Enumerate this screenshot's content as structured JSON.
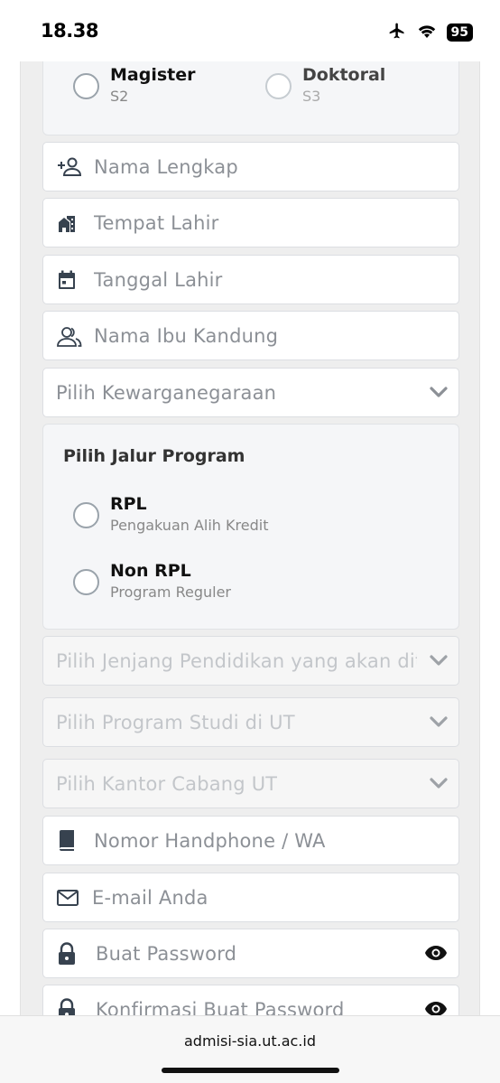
{
  "status": {
    "time": "18.38",
    "battery": "95"
  },
  "degree": {
    "options": [
      {
        "title": "Magister",
        "subtitle": "S2"
      },
      {
        "title": "Doktoral",
        "subtitle": "S3"
      }
    ]
  },
  "form": {
    "full_name": "Nama Lengkap",
    "birth_place": "Tempat Lahir",
    "birth_date": "Tanggal Lahir",
    "mother_name": "Nama Ibu Kandung",
    "citizenship": "Pilih Kewarganegaraan",
    "program_path": {
      "title": "Pilih Jalur Program",
      "options": [
        {
          "title": "RPL",
          "subtitle": "Pengakuan Alih Kredit"
        },
        {
          "title": "Non RPL",
          "subtitle": "Program Reguler"
        }
      ]
    },
    "education_level": "Pilih Jenjang Pendidikan yang akan dit",
    "study_program": "Pilih Program Studi di UT",
    "branch_office": "Pilih Kantor Cabang UT",
    "phone": "Nomor Handphone / WA",
    "email": "E-mail Anda",
    "password": "Buat Password",
    "confirm_password": "Konfirmasi Buat Password"
  },
  "browser": {
    "url": "admisi-sia.ut.ac.id"
  },
  "colors": {
    "icon": "#37424f",
    "placeholder": "#8c9096",
    "disabled": "#c3c6ca"
  }
}
